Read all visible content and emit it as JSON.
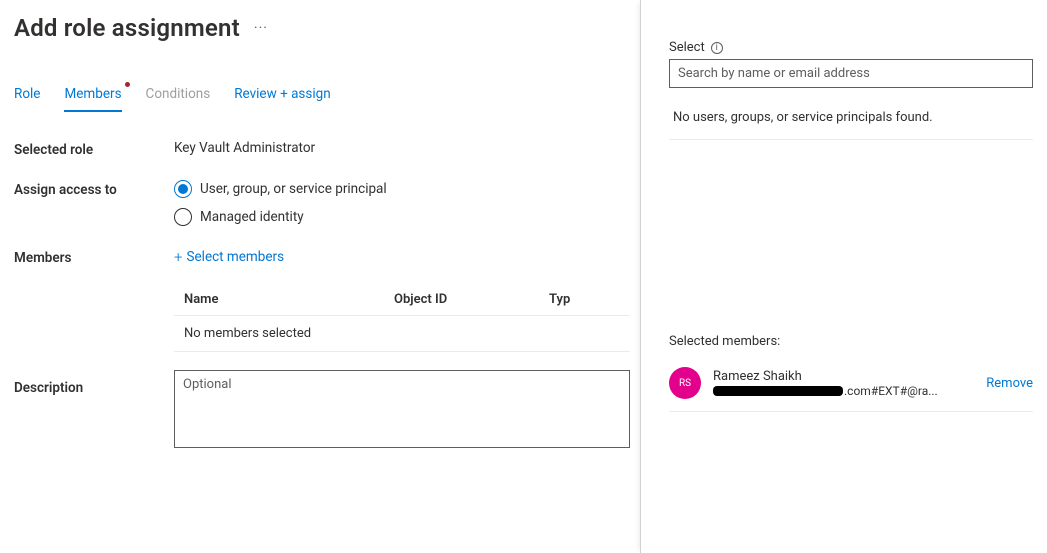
{
  "header": {
    "title": "Add role assignment"
  },
  "tabs": {
    "role": "Role",
    "members": "Members",
    "conditions": "Conditions",
    "review": "Review + assign"
  },
  "form": {
    "selected_role_label": "Selected role",
    "selected_role_value": "Key Vault Administrator",
    "assign_access_label": "Assign access to",
    "radio_user": "User, group, or service principal",
    "radio_managed": "Managed identity",
    "members_label": "Members",
    "select_members_link": "Select members",
    "table": {
      "col_name": "Name",
      "col_objectid": "Object ID",
      "col_type": "Typ",
      "empty": "No members selected"
    },
    "description_label": "Description",
    "description_placeholder": "Optional"
  },
  "side": {
    "select_label": "Select",
    "search_placeholder": "Search by name or email address",
    "no_results": "No users, groups, or service principals found.",
    "selected_members_label": "Selected members:",
    "member": {
      "initials": "RS",
      "name": "Rameez Shaikh",
      "email_suffix": ".com#EXT#@ra...",
      "remove": "Remove"
    }
  }
}
